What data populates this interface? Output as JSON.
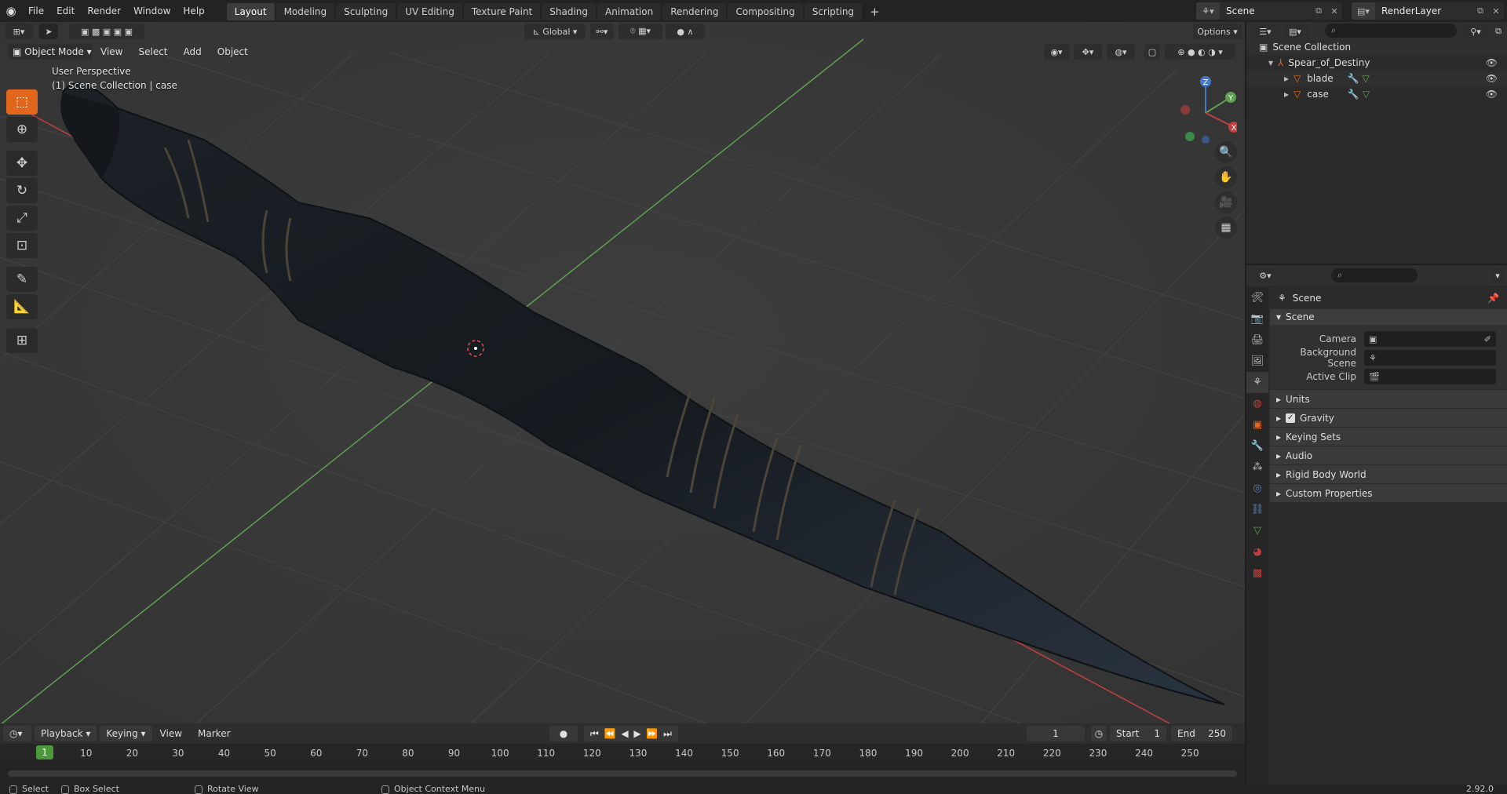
{
  "top_menu": [
    "File",
    "Edit",
    "Render",
    "Window",
    "Help"
  ],
  "workspace_tabs": [
    {
      "label": "Layout",
      "active": true
    },
    {
      "label": "Modeling"
    },
    {
      "label": "Sculpting"
    },
    {
      "label": "UV Editing"
    },
    {
      "label": "Texture Paint"
    },
    {
      "label": "Shading"
    },
    {
      "label": "Animation"
    },
    {
      "label": "Rendering"
    },
    {
      "label": "Compositing"
    },
    {
      "label": "Scripting"
    }
  ],
  "scene_name": "Scene",
  "view_layer": "RenderLayer",
  "viewport": {
    "mode": "Object Mode",
    "menus": [
      "View",
      "Select",
      "Add",
      "Object"
    ],
    "transform_orientation": "Global",
    "options_label": "Options",
    "perspective_label": "User Perspective",
    "collection_label": "(1) Scene Collection | case"
  },
  "outliner": {
    "root": "Scene Collection",
    "items": [
      {
        "name": "Spear_of_Destiny",
        "level": 1
      },
      {
        "name": "blade",
        "level": 2
      },
      {
        "name": "case",
        "level": 2
      }
    ]
  },
  "properties": {
    "context_title": "Scene",
    "panel_title": "Scene",
    "fields": [
      {
        "label": "Camera"
      },
      {
        "label": "Background Scene"
      },
      {
        "label": "Active Clip"
      }
    ],
    "subpanels": [
      {
        "label": "Units"
      },
      {
        "label": "Gravity",
        "checked": true
      },
      {
        "label": "Keying Sets"
      },
      {
        "label": "Audio"
      },
      {
        "label": "Rigid Body World"
      },
      {
        "label": "Custom Properties"
      }
    ]
  },
  "timeline": {
    "playback_label": "Playback",
    "keying_label": "Keying",
    "menus": [
      "View",
      "Marker"
    ],
    "current_frame": "1",
    "start_label": "Start",
    "start_value": "1",
    "end_label": "End",
    "end_value": "250",
    "ticks": [
      "10",
      "20",
      "30",
      "40",
      "50",
      "60",
      "70",
      "80",
      "90",
      "100",
      "110",
      "120",
      "130",
      "140",
      "150",
      "160",
      "170",
      "180",
      "190",
      "200",
      "210",
      "220",
      "230",
      "240",
      "250"
    ]
  },
  "status_bar": {
    "select": "Select",
    "box_select": "Box Select",
    "rotate_view": "Rotate View",
    "context_menu": "Object Context Menu",
    "version": "2.92.0"
  },
  "colors": {
    "accent_orange": "#e2671d",
    "active_blue": "#5a81b6",
    "frame_green": "#4a9a3a",
    "axis_x": "#c0403f",
    "axis_y": "#5fa052",
    "axis_z": "#4a78c8"
  }
}
